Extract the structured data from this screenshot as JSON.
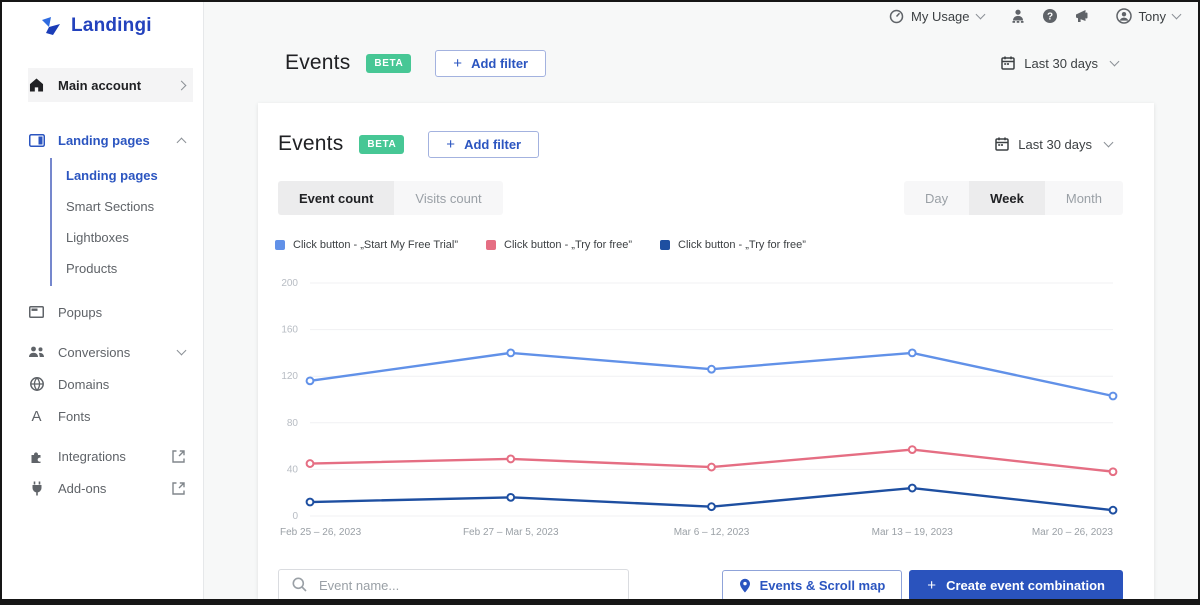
{
  "brand": {
    "name": "Landingi"
  },
  "topbar": {
    "my_usage": "My Usage",
    "user": "Tony"
  },
  "sidebar": {
    "main_account": "Main account",
    "landing_pages_group": "Landing pages",
    "landing_sub": [
      "Landing pages",
      "Smart Sections",
      "Lightboxes",
      "Products"
    ],
    "popups": "Popups",
    "conversions": "Conversions",
    "domains": "Domains",
    "fonts": "Fonts",
    "integrations": "Integrations",
    "addons": "Add-ons"
  },
  "icons": {
    "plus": "+",
    "fonts_letter": "A",
    "help": "?"
  },
  "page_header": {
    "title": "Events",
    "beta": "BETA",
    "add_filter_label": "Add filter",
    "date_range": "Last 30 days"
  },
  "card": {
    "title": "Events",
    "beta": "BETA",
    "add_filter_label": "Add filter",
    "date_range": "Last 30 days",
    "count_tabs": [
      {
        "label": "Event count",
        "active": true
      },
      {
        "label": "Visits count",
        "active": false
      }
    ],
    "period_tabs": [
      {
        "label": "Day",
        "active": false
      },
      {
        "label": "Week",
        "active": true
      },
      {
        "label": "Month",
        "active": false
      }
    ]
  },
  "chart_data": {
    "type": "line",
    "title": "",
    "xlabel": "",
    "ylabel": "",
    "categories": [
      "Feb 25 – 26, 2023",
      "Feb 27 – Mar 5, 2023",
      "Mar 6 – 12, 2023",
      "Mar 13 – 19, 2023",
      "Mar 20 – 26, 2023"
    ],
    "yticks": [
      0,
      40,
      80,
      120,
      160,
      200
    ],
    "ylim": [
      0,
      200
    ],
    "grid": true,
    "legend_position": "top",
    "series": [
      {
        "name": "Click button - „Start My Free Trial”",
        "color": "#6191e8",
        "values": [
          116,
          140,
          126,
          140,
          103
        ]
      },
      {
        "name": "Click button - „Try for free”",
        "color": "#e56e83",
        "values": [
          45,
          49,
          42,
          57,
          38
        ]
      },
      {
        "name": "Click button - „Try for free”",
        "color": "#1e4fa1",
        "values": [
          12,
          16,
          8,
          24,
          5
        ]
      }
    ]
  },
  "footer": {
    "search_placeholder": "Event name...",
    "events_scroll_map": "Events & Scroll map",
    "create_event_combination": "Create event combination"
  }
}
